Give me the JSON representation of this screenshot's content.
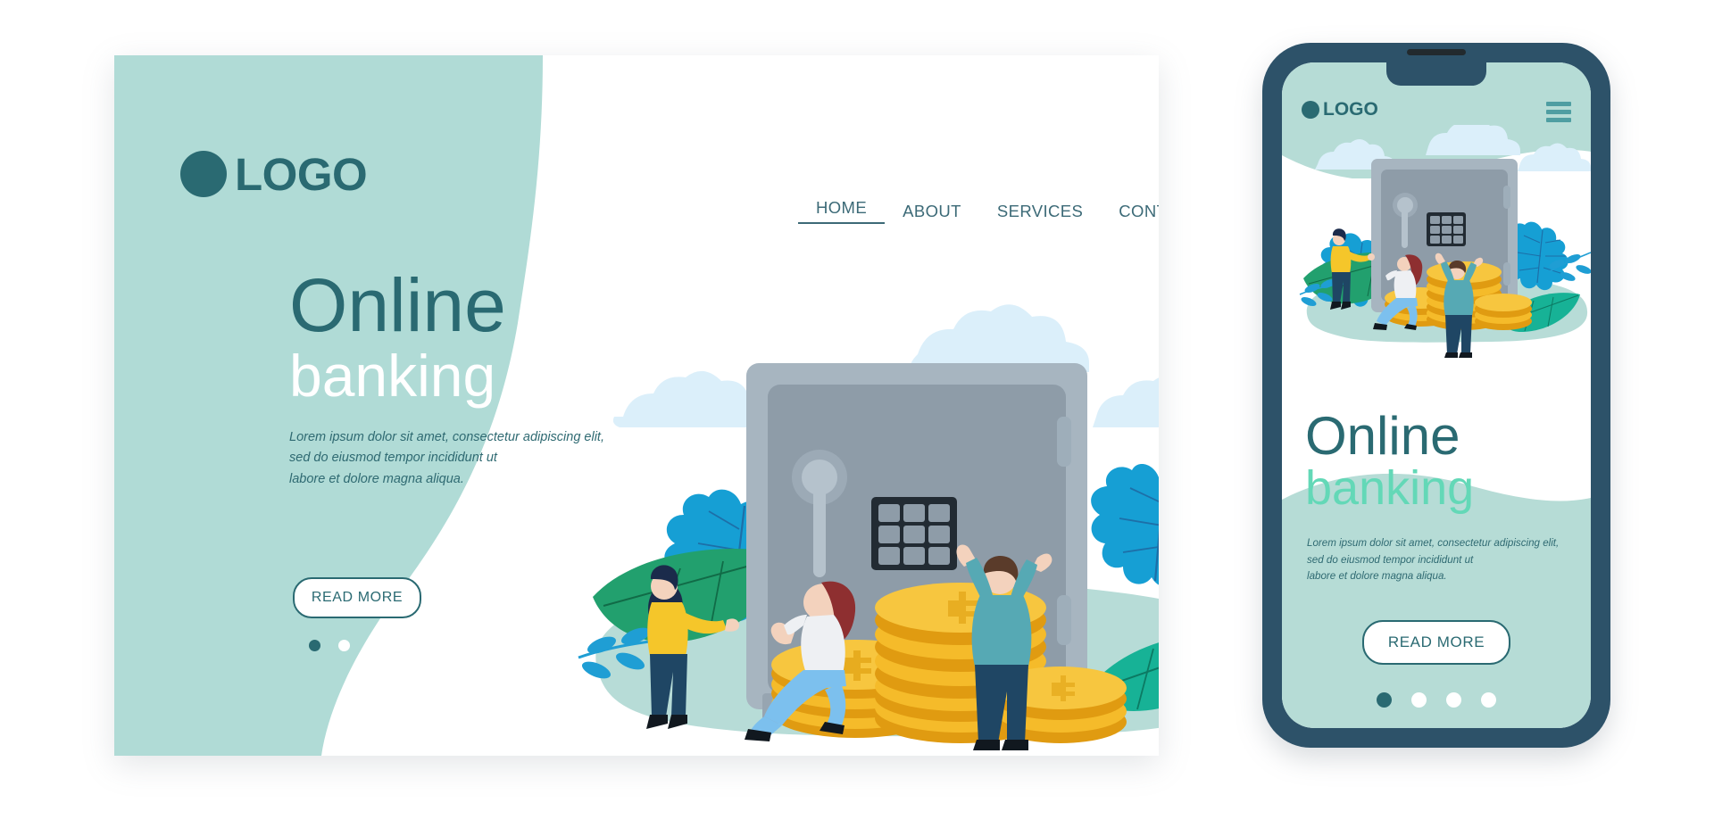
{
  "brand": {
    "logo_text": "LOGO",
    "colors": {
      "mint": "#b0dbd6",
      "teal_dark": "#2a6a72",
      "teal_nav": "#3c6a77",
      "accent_green": "#63d8b7",
      "phone_bezel": "#2d5269",
      "cloud": "#dbeffa",
      "leaf_blue": "#1f9ed4",
      "leaf_green": "#23a06f",
      "coin_gold": "#f2b01e",
      "safe_gray": "#8d9aa6"
    }
  },
  "desktop": {
    "nav": {
      "items": [
        {
          "label": "HOME",
          "active": true
        },
        {
          "label": "ABOUT",
          "active": false
        },
        {
          "label": "SERVICES",
          "active": false
        },
        {
          "label": "CONTACT",
          "active": false
        }
      ],
      "menu_icon": "hamburger-icon"
    },
    "hero": {
      "title_line1": "Online",
      "title_line2": "banking",
      "body": "Lorem ipsum dolor sit amet, consectetur adipiscing elit, sed do eiusmod tempor incididunt ut labore et dolore magna aliqua.",
      "body_lines": [
        "Lorem ipsum dolor sit amet, consectetur adipiscing elit,",
        "sed do eiusmod tempor incididunt ut",
        "labore et dolore magna aliqua."
      ],
      "cta_label": "READ MORE",
      "carousel": {
        "total": 4,
        "active_index": 0
      }
    }
  },
  "phone": {
    "logo_text": "LOGO",
    "menu_icon": "hamburger-icon",
    "hero": {
      "title_line1": "Online",
      "title_line2": "banking",
      "body_lines": [
        "Lorem ipsum dolor sit amet, consectetur adipiscing elit,",
        "sed do eiusmod tempor incididunt ut",
        "labore et dolore magna aliqua."
      ],
      "cta_label": "READ MORE",
      "carousel": {
        "total": 4,
        "active_index": 0
      }
    }
  },
  "illustration": {
    "name": "online-banking-safe-illustration",
    "elements": [
      "bank-safe",
      "keypad",
      "safe-handle",
      "gold-coin-stack",
      "woman-yellow-sweater",
      "woman-sitting-on-coins",
      "man-arms-raised",
      "blue-oak-leaf",
      "green-leaf",
      "leaf-branch",
      "clouds",
      "mint-ground"
    ]
  }
}
